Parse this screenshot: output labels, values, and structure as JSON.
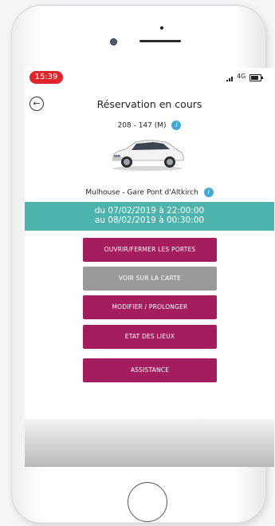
{
  "status_bar": {
    "time": "15:39",
    "network": "4G",
    "time_pill_color": "#e0262c"
  },
  "header": {
    "title": "Réservation en cours",
    "back_icon": "back-arrow-icon"
  },
  "vehicle": {
    "plate": "208 - 147 (M)",
    "info_icon": "info-icon",
    "image": "car-image"
  },
  "location": {
    "name": "Mulhouse - Gare Pont d'Altkirch"
  },
  "dates": {
    "from": "du 07/02/2019 à 22:00:00",
    "to": "au 08/02/2019 à 00:30:00",
    "band_color": "#4db3ad"
  },
  "actions": {
    "open_close": "OUVRIR/FERMER LES PORTES",
    "view_map": "VOIR SUR LA CARTE",
    "modify": "MODIFIER / PROLONGER",
    "inspection": "ETAT DES LIEUX",
    "assistance": "ASSISTANCE",
    "primary_color": "#a41d5f",
    "disabled_color": "#9a9a9a"
  }
}
